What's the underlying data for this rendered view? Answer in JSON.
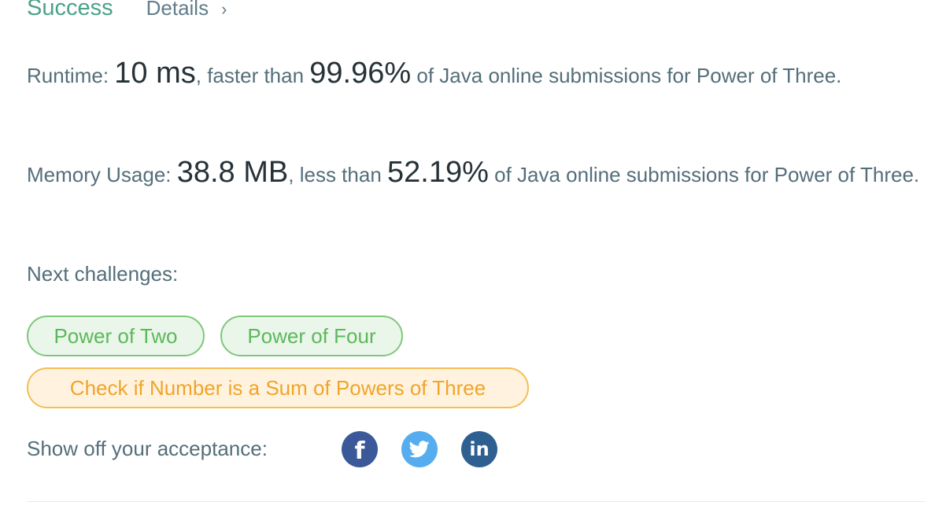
{
  "header": {
    "status": "Success",
    "details_label": "Details",
    "details_chevron": "›"
  },
  "runtime": {
    "label": "Runtime: ",
    "value": "10 ms",
    "comparison": ", faster than ",
    "percent": "99.96%",
    "suffix": " of Java online submissions for Power of Three."
  },
  "memory": {
    "label": "Memory Usage: ",
    "value": "38.8 MB",
    "comparison": ", less than ",
    "percent": "52.19%",
    "suffix": " of Java online submissions for Power of Three."
  },
  "next_challenges": {
    "label": "Next challenges:",
    "items": [
      {
        "title": "Power of Two",
        "difficulty": "easy"
      },
      {
        "title": "Power of Four",
        "difficulty": "easy"
      },
      {
        "title": "Check if Number is a Sum of Powers of Three",
        "difficulty": "medium"
      }
    ]
  },
  "share": {
    "label": "Show off your acceptance:",
    "icons": [
      "facebook-icon",
      "twitter-icon",
      "linkedin-icon"
    ],
    "facebook_glyph": "f",
    "linkedin_glyph": "in"
  },
  "colors": {
    "success": "#4aa28a",
    "easy": "#5cb85c",
    "medium": "#f0a428",
    "facebook": "#3b5998",
    "twitter": "#55acee",
    "linkedin": "#2e5f91"
  }
}
